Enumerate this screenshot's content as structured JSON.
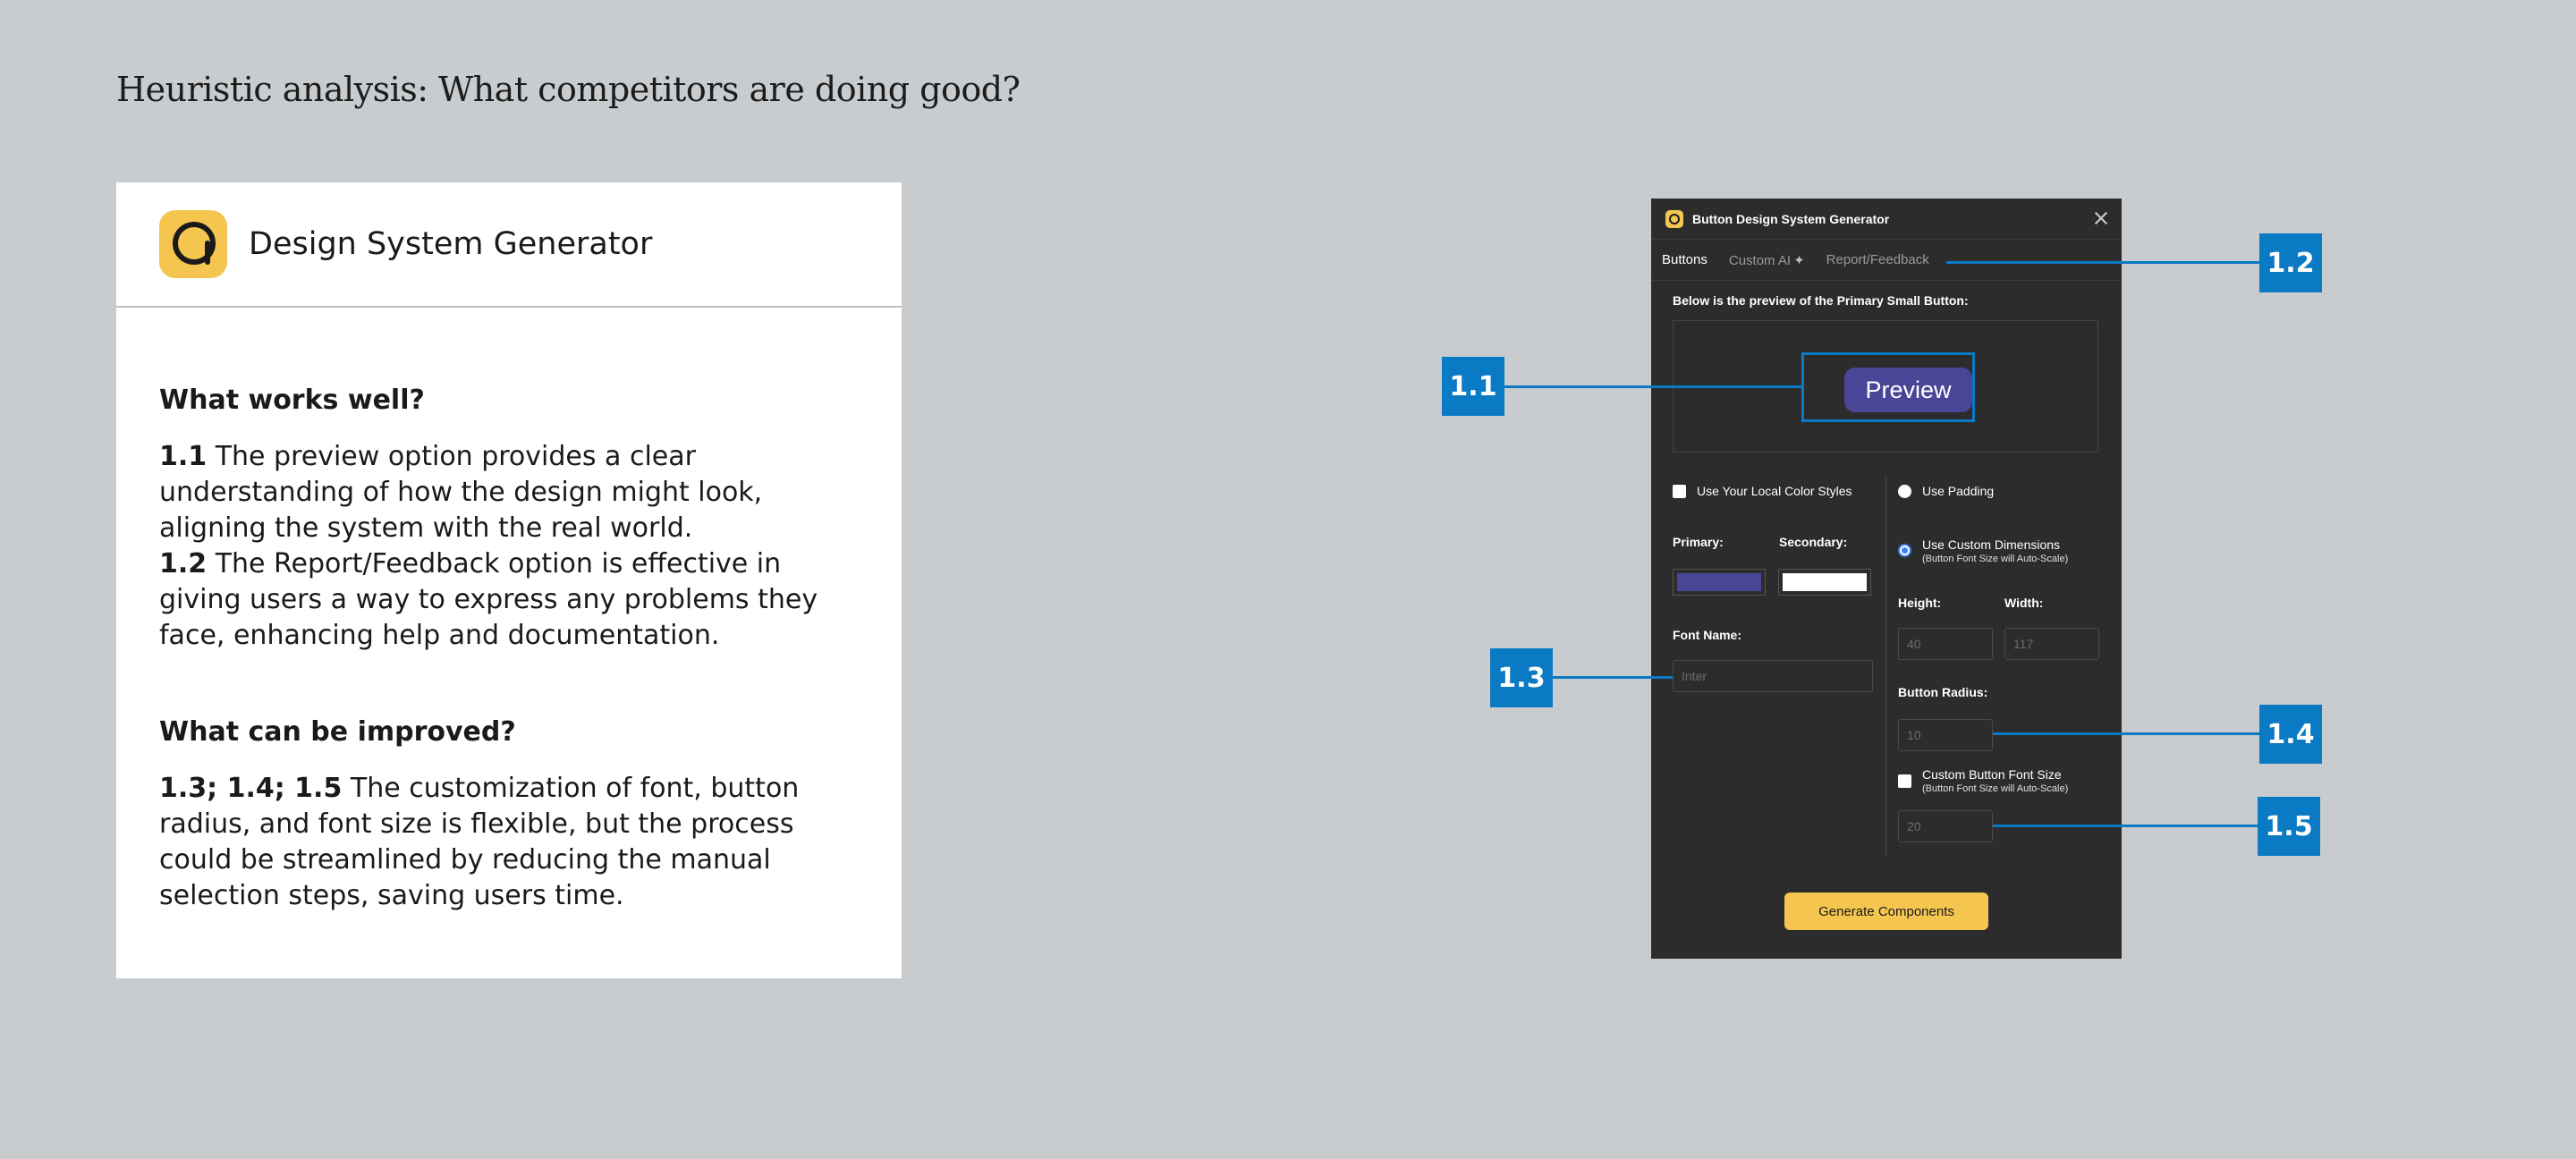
{
  "heading": "Heuristic analysis: What competitors are doing good?",
  "card": {
    "title": "Design System Generator",
    "works_title": "What works well?",
    "p1_num": "1.1",
    "p1_text": " The preview option provides a clear understanding of how the design might look, aligning the system with the real world.",
    "p2_num": "1.2",
    "p2_text": " The Report/Feedback option is effective in giving users a way to express any problems they face, enhancing help and documentation.",
    "improve_title": "What can be improved?",
    "p3_num": "1.3; 1.4; 1.5",
    "p3_text": " The customization of font, button radius, and font size is flexible, but the process could be streamlined by reducing the manual selection steps, saving users time."
  },
  "plugin": {
    "title": "Button Design System Generator",
    "tabs": [
      "Buttons",
      "Custom AI",
      "Report/Feedback"
    ],
    "tab_sparkle": "✦",
    "preview_label": "Below is the preview of the Primary Small Button:",
    "preview_button": "Preview",
    "local_color_styles": "Use Your Local Color Styles",
    "primary_label": "Primary:",
    "secondary_label": "Secondary:",
    "primary_color": "#4a4697",
    "secondary_color": "#ffffff",
    "font_name_label": "Font Name:",
    "font_name_placeholder": "Inter",
    "use_padding": "Use Padding",
    "use_custom_dimensions": "Use Custom Dimensions",
    "auto_scale_note": "(Button Font Size will Auto-Scale)",
    "height_label": "Height:",
    "width_label": "Width:",
    "height_value": "40",
    "width_value": "117",
    "radius_label": "Button Radius:",
    "radius_value": "10",
    "custom_font_size": "Custom Button Font Size",
    "font_size_value": "20",
    "generate_button": "Generate Components"
  },
  "callouts": [
    "1.1",
    "1.2",
    "1.3",
    "1.4",
    "1.5"
  ],
  "colors": {
    "accent": "#0a7ac4",
    "brand": "#f5c64f",
    "background": "#c9cccf"
  }
}
